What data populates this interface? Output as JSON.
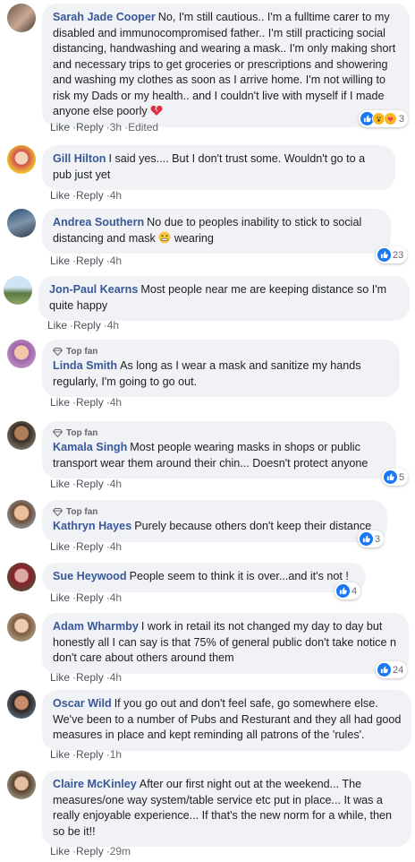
{
  "actions": {
    "like": "Like",
    "reply": "Reply",
    "edited": "Edited",
    "top_fan": "Top fan"
  },
  "comments": [
    {
      "name": "Sarah Jade Cooper",
      "text": "No, I'm still cautious.. I'm a fulltime carer to my disabled and immunocompromised father.. I'm still practicing social distancing, handwashing and wearing a mask.. I'm only making short and necessary trips to get groceries or prescriptions and showering and washing my clothes as soon as I arrive home. I'm not willing to risk my Dads or my health.. and I couldn't live with myself if I made anyone else poorly",
      "time": "3h",
      "reactions": "3"
    },
    {
      "name": "Gill Hilton",
      "text": "I said yes.... But I don't trust some. Wouldn't go to a pub just yet",
      "time": "4h"
    },
    {
      "name": "Andrea Southern",
      "text_before": "No due to peoples inability to stick to social distancing and mask",
      "text_after": "wearing",
      "time": "4h",
      "reactions": "23"
    },
    {
      "name": "Jon-Paul Kearns",
      "text": "Most people near me are keeping distance so I'm quite happy",
      "time": "4h"
    },
    {
      "name": "Linda Smith",
      "text": "As long as I wear a mask and sanitize my hands regularly, I'm going to go out.",
      "time": "4h"
    },
    {
      "name": "Kamala Singh",
      "text": "Most people wearing masks in shops or public transport wear them around their chin... Doesn't protect anyone",
      "time": "4h",
      "reactions": "5"
    },
    {
      "name": "Kathryn Hayes",
      "text": "Purely because others don't keep their distance",
      "time": "4h",
      "reactions": "3"
    },
    {
      "name": "Sue Heywood",
      "text": "People seem to think it is over...and it's not !",
      "time": "4h",
      "reactions": "4"
    },
    {
      "name": "Adam Wharmby",
      "text": "I work in retail its not changed my day to day but honestly all I can say is that 75% of general public don't take notice n don't care about others around them",
      "time": "4h",
      "reactions": "24"
    },
    {
      "name": "Oscar Wild",
      "text": "If you go out and don't feel safe, go somewhere else. We've been to a number of Pubs and Resturant and they all had good measures in place and kept reminding all patrons of the 'rules'.",
      "time": "1h"
    },
    {
      "name": "Claire McKinley",
      "text": "After our first night out at the weekend... The measures/one way system/table service etc put in place... It was a really enjoyable experience... If that's the new norm for a while, then so be it!!",
      "time": "29m"
    }
  ],
  "colors": {
    "name": "#385898",
    "bubble": "#f0f2f5",
    "like_blue": "#1877f2",
    "meta": "#65676b"
  }
}
